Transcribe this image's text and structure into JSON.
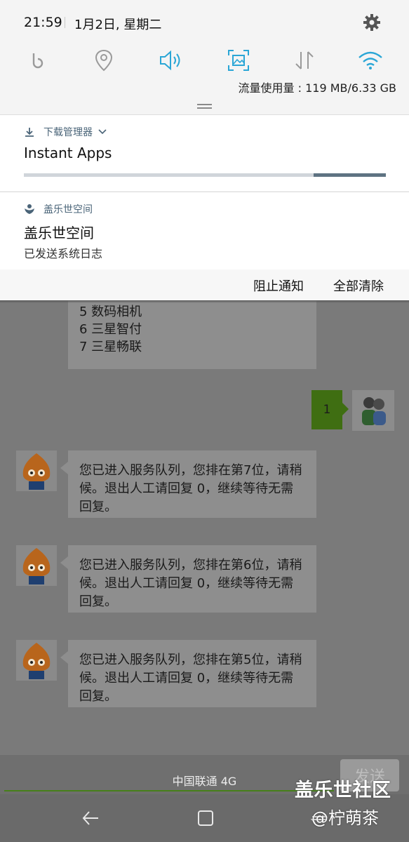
{
  "status_bar": {
    "time": "21:59",
    "date": "1月2日, 星期二",
    "data_usage": "流量使用量 : 119 MB/6.33 GB"
  },
  "quick_settings": [
    {
      "name": "bixby-icon",
      "active": false
    },
    {
      "name": "location-icon",
      "active": false
    },
    {
      "name": "sound-icon",
      "active": true
    },
    {
      "name": "screenshot-icon",
      "active": true
    },
    {
      "name": "mobile-data-icon",
      "active": false
    },
    {
      "name": "wifi-icon",
      "active": true
    }
  ],
  "colors": {
    "accent": "#2aa6d6",
    "inactive_icon": "#9a9a9a",
    "app_label": "#4a6478",
    "user_bubble": "#3f6e12"
  },
  "notifications": [
    {
      "app": "下载管理器",
      "title": "Instant Apps",
      "progress": 0.2
    },
    {
      "app": "盖乐世空间",
      "title": "盖乐世空间",
      "text": "已发送系统日志"
    }
  ],
  "actions": {
    "block": "阻止通知",
    "clear_all": "全部清除"
  },
  "chat": {
    "partial_bubble_lines": [
      "5 数码相机",
      "6 三星智付",
      "7 三星畅联"
    ],
    "user_message": "1",
    "bot_messages": [
      "您已进入服务队列，您排在第7位，请稍候。退出人工请回复 0，继续等待无需回复。",
      "您已进入服务队列，您排在第6位，请稍候。退出人工请回复 0，继续等待无需回复。",
      "您已进入服务队列，您排在第5位，请稍候。退出人工请回复 0，继续等待无需回复。"
    ],
    "send_label": "发送",
    "carrier": "中国联通 4G"
  },
  "watermark": {
    "line1": "盖乐世社区",
    "line2": "@柠萌茶"
  }
}
